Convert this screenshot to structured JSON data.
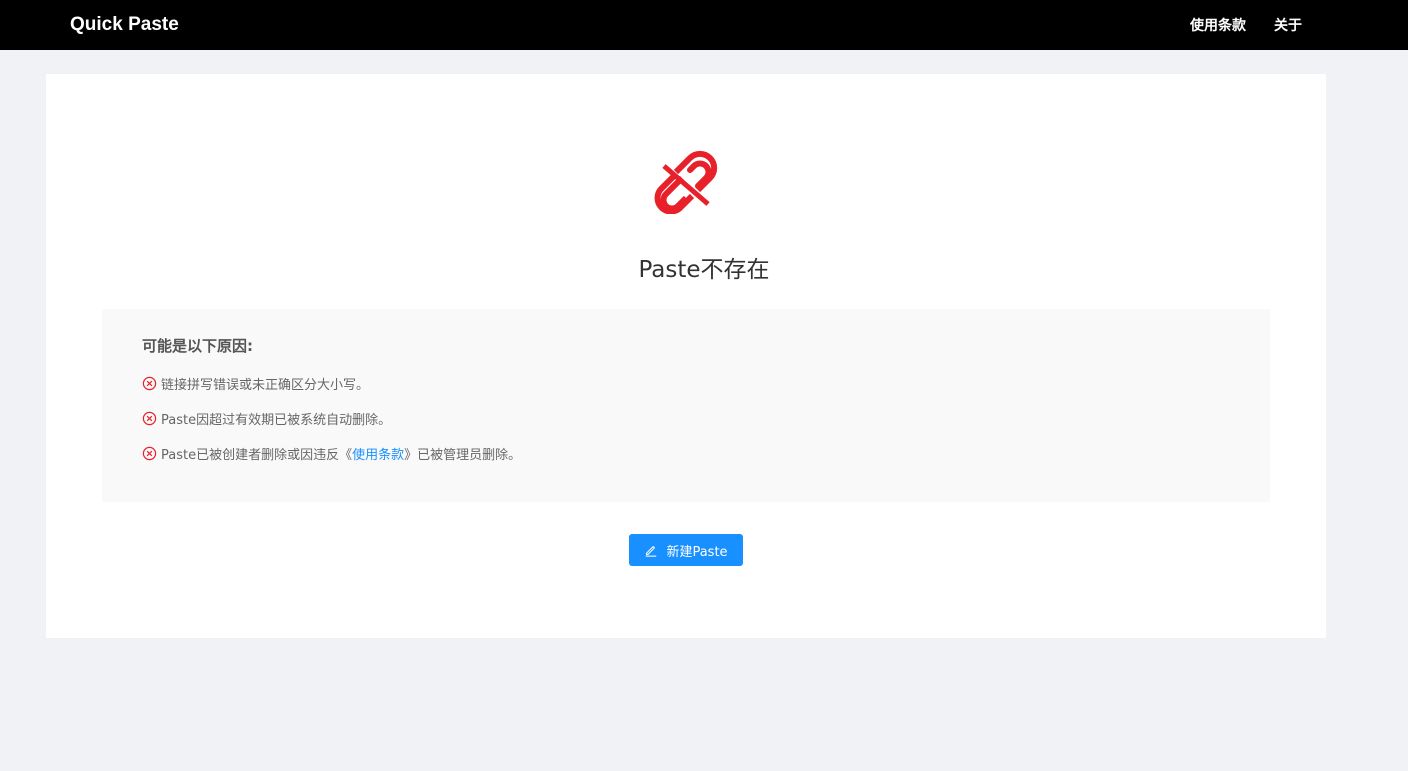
{
  "header": {
    "brand": "Quick Paste",
    "nav": [
      {
        "label": "使用条款"
      },
      {
        "label": "关于"
      }
    ]
  },
  "main": {
    "icon": "broken-link-icon",
    "title": "Paste不存在",
    "reasons_title": "可能是以下原因:",
    "reasons": [
      {
        "text": "链接拼写错误或未正确区分大小写。"
      },
      {
        "text": "Paste因超过有效期已被系统自动删除。"
      },
      {
        "prefix": "Paste已被创建者删除或因违反《",
        "link": "使用条款",
        "suffix": "》已被管理员删除。"
      }
    ],
    "new_button": "新建Paste",
    "new_button_icon": "edit-icon"
  },
  "colors": {
    "accent": "#1890ff",
    "error": "#e8202a",
    "navbar": "#000000"
  }
}
